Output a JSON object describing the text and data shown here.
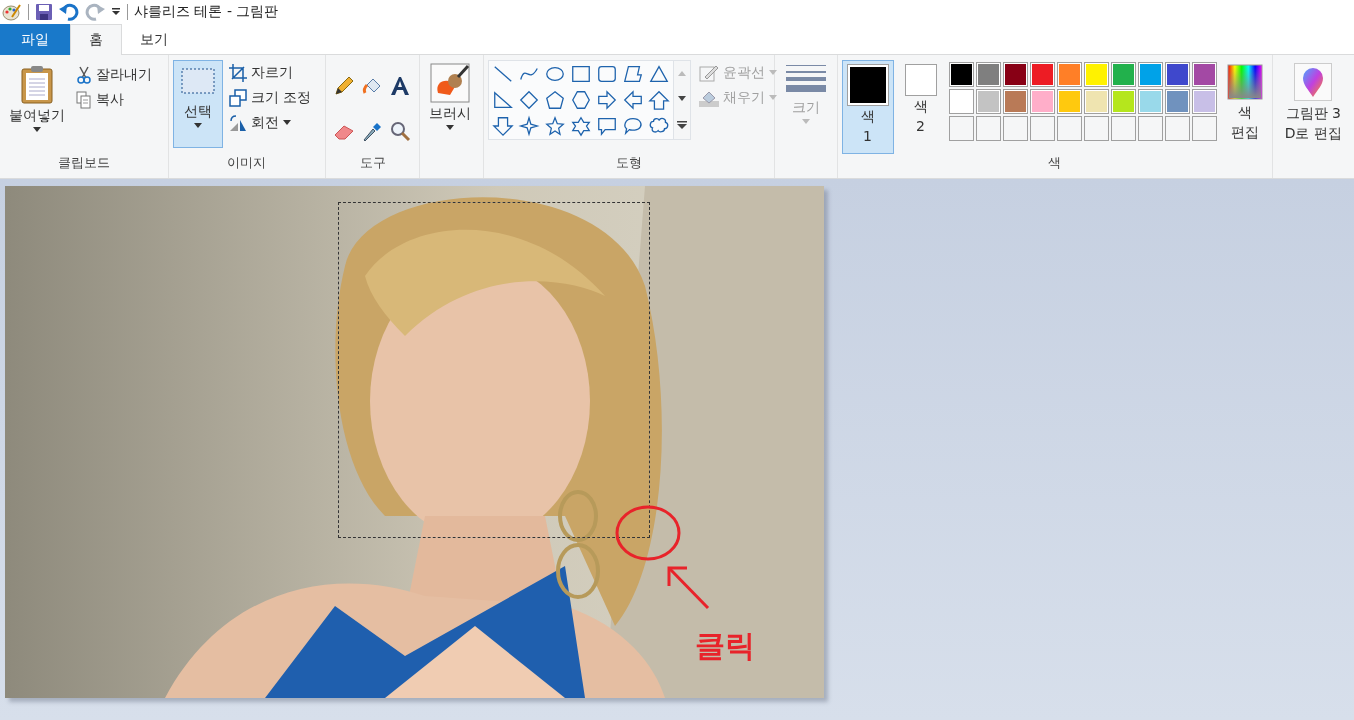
{
  "window": {
    "title": "샤를리즈 테론 - 그림판"
  },
  "tabs": [
    {
      "label": "파일",
      "kind": "file",
      "selected": false
    },
    {
      "label": "홈",
      "kind": "tab",
      "selected": true
    },
    {
      "label": "보기",
      "kind": "tab",
      "selected": false
    }
  ],
  "clipboard": {
    "label": "클립보드",
    "paste": "붙여넣기",
    "cut": "잘라내기",
    "copy": "복사"
  },
  "image": {
    "label": "이미지",
    "select": {
      "label": "선택",
      "selected": true
    },
    "crop": "자르기",
    "resize": "크기 조정",
    "rotate": "회전"
  },
  "tools": {
    "label": "도구"
  },
  "brushes": {
    "label": "브러시"
  },
  "shapes": {
    "label": "도형",
    "outline": {
      "label": "윤곽선",
      "disabled": true
    },
    "fill": {
      "label": "채우기",
      "disabled": true
    }
  },
  "size": {
    "label": "크기",
    "disabled": true
  },
  "colors": {
    "label": "색",
    "current": [
      {
        "label": "색\n1",
        "selected": true,
        "color": "#000000"
      },
      {
        "label": "색\n2",
        "selected": false,
        "color": "#ffffff"
      }
    ],
    "palette": [
      {
        "color": "#000000"
      },
      {
        "color": "#7f7f7f"
      },
      {
        "color": "#880015"
      },
      {
        "color": "#ed1c24"
      },
      {
        "color": "#ff7f27"
      },
      {
        "color": "#fff200"
      },
      {
        "color": "#22b14c"
      },
      {
        "color": "#00a2e8"
      },
      {
        "color": "#3f48cc"
      },
      {
        "color": "#a349a4"
      },
      {
        "color": "#ffffff"
      },
      {
        "color": "#c3c3c3"
      },
      {
        "color": "#b97a57"
      },
      {
        "color": "#ffaec9"
      },
      {
        "color": "#ffc90e"
      },
      {
        "color": "#efe4b0"
      },
      {
        "color": "#b5e61d"
      },
      {
        "color": "#99d9ea"
      },
      {
        "color": "#7092be"
      },
      {
        "color": "#c8bfe7"
      },
      {
        "kind": "empty"
      },
      {
        "kind": "empty"
      },
      {
        "kind": "empty"
      },
      {
        "kind": "empty"
      },
      {
        "kind": "empty"
      },
      {
        "kind": "empty"
      },
      {
        "kind": "empty"
      },
      {
        "kind": "empty"
      },
      {
        "kind": "empty"
      },
      {
        "kind": "empty"
      }
    ],
    "edit": "색\n편집"
  },
  "paint3d": {
    "label": "그림판 3\nD로 편집"
  },
  "canvas": {
    "annotation": {
      "label": "클릭"
    }
  }
}
